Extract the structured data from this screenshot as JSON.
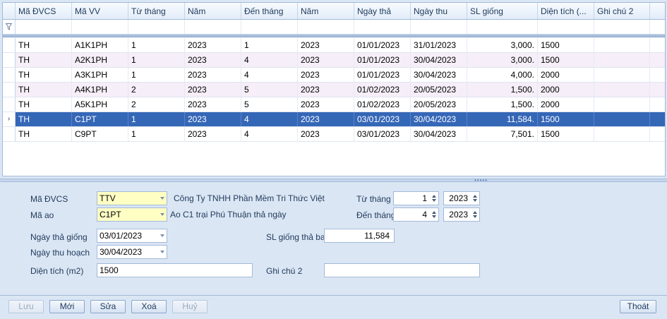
{
  "grid": {
    "columns": [
      "Mã ĐVCS",
      "Mã VV",
      "Từ tháng",
      "Năm",
      "Đến tháng",
      "Năm",
      "Ngày thả",
      "Ngày thu",
      "SL giống",
      "Diện tích (...",
      "Ghi chú 2"
    ],
    "rows": [
      [
        "TH",
        "A1K1PH",
        "1",
        "2023",
        "1",
        "2023",
        "01/01/2023",
        "31/01/2023",
        "3,000.",
        "1500",
        ""
      ],
      [
        "TH",
        "A2K1PH",
        "1",
        "2023",
        "4",
        "2023",
        "01/01/2023",
        "30/04/2023",
        "3,000.",
        "1500",
        ""
      ],
      [
        "TH",
        "A3K1PH",
        "1",
        "2023",
        "4",
        "2023",
        "01/01/2023",
        "30/04/2023",
        "4,000.",
        "2000",
        ""
      ],
      [
        "TH",
        "A4K1PH",
        "2",
        "2023",
        "5",
        "2023",
        "01/02/2023",
        "20/05/2023",
        "1,500.",
        "2000",
        ""
      ],
      [
        "TH",
        "A5K1PH",
        "2",
        "2023",
        "5",
        "2023",
        "01/02/2023",
        "20/05/2023",
        "1,500.",
        "2000",
        ""
      ],
      [
        "TH",
        "C1PT",
        "1",
        "2023",
        "4",
        "2023",
        "03/01/2023",
        "30/04/2023",
        "11,584.",
        "1500",
        ""
      ],
      [
        "TH",
        "C9PT",
        "1",
        "2023",
        "4",
        "2023",
        "03/01/2023",
        "30/04/2023",
        "7,501.",
        "1500",
        ""
      ]
    ],
    "selected_row_index": 5,
    "current_row_marker": "›",
    "filter_icon": "funnel-icon"
  },
  "form": {
    "ma_dvcs_label": "Mã ĐVCS",
    "ma_dvcs_value": "TTV",
    "ma_dvcs_desc": "Công Ty TNHH Phần Mềm Tri Thức Việt",
    "ma_ao_label": "Mã ao",
    "ma_ao_value": "C1PT",
    "ma_ao_desc": "Ao C1 trại Phú Thuận thả ngày",
    "tu_thang_label": "Từ tháng",
    "tu_thang_month": "1",
    "tu_thang_year": "2023",
    "den_thang_label": "Đến tháng",
    "den_thang_month": "4",
    "den_thang_year": "2023",
    "ngay_tha_label": "Ngày thả giống",
    "ngay_tha_value": "03/01/2023",
    "ngay_thu_label": "Ngày thu hoạch",
    "ngay_thu_value": "30/04/2023",
    "sl_giong_label": "SL giống thả ban",
    "sl_giong_value": "11,584",
    "dien_tich_label": "Diện tích (m2)",
    "dien_tich_value": "1500",
    "ghi_chu_label": "Ghi chú 2",
    "ghi_chu_value": ""
  },
  "buttons": {
    "luu": "Lưu",
    "moi": "Mới",
    "sua": "Sửa",
    "xoa": "Xoá",
    "huy": "Huỷ",
    "thoat": "Thoát"
  },
  "colors": {
    "selection": "#3567b7",
    "alt_row": "#f6eef8",
    "highlight_field": "#ffffc4",
    "panel": "#dbe6f4"
  }
}
